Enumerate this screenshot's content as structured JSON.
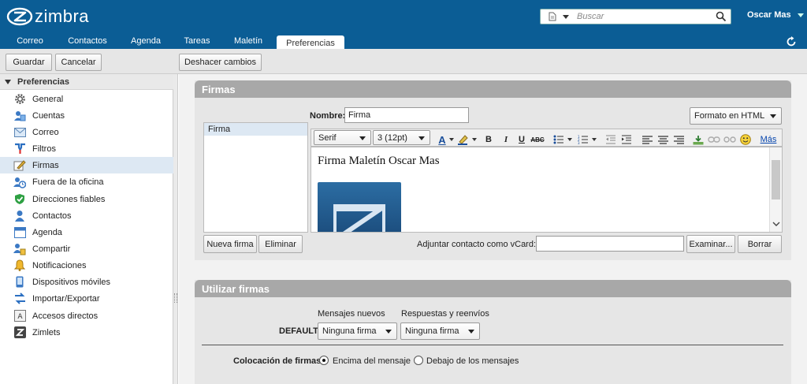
{
  "header": {
    "logo_text": "zimbra",
    "search_placeholder": "Buscar",
    "user_name": "Oscar Mas"
  },
  "nav": {
    "tabs": [
      "Correo",
      "Contactos",
      "Agenda",
      "Tareas",
      "Maletín",
      "Preferencias"
    ],
    "active_tab": "Preferencias"
  },
  "toolbar": {
    "save_label": "Guardar",
    "cancel_label": "Cancelar",
    "undo_label": "Deshacer cambios"
  },
  "sidebar": {
    "title": "Preferencias",
    "items": [
      {
        "label": "General",
        "icon": "gear-icon"
      },
      {
        "label": "Cuentas",
        "icon": "accounts-icon"
      },
      {
        "label": "Correo",
        "icon": "mail-icon"
      },
      {
        "label": "Filtros",
        "icon": "filter-icon"
      },
      {
        "label": "Firmas",
        "icon": "signature-icon"
      },
      {
        "label": "Fuera de la oficina",
        "icon": "out-of-office-icon"
      },
      {
        "label": "Direcciones fiables",
        "icon": "shield-icon"
      },
      {
        "label": "Contactos",
        "icon": "contacts-icon"
      },
      {
        "label": "Agenda",
        "icon": "calendar-icon"
      },
      {
        "label": "Compartir",
        "icon": "share-icon"
      },
      {
        "label": "Notificaciones",
        "icon": "bell-icon"
      },
      {
        "label": "Dispositivos móviles",
        "icon": "mobile-icon"
      },
      {
        "label": "Importar/Exportar",
        "icon": "import-export-icon"
      },
      {
        "label": "Accesos directos",
        "icon": "shortcuts-icon"
      },
      {
        "label": "Zimlets",
        "icon": "zimlets-icon"
      }
    ],
    "selected": "Firmas"
  },
  "firmas": {
    "title": "Firmas",
    "list": [
      "Firma"
    ],
    "name_label": "Nombre:",
    "name_value": "Firma",
    "format_select": "Formato en HTML",
    "font_family": "Serif",
    "font_size": "3 (12pt)",
    "more_link": "Más",
    "editor_text": "Firma Maletín Oscar Mas",
    "new_button": "Nueva firma",
    "delete_button": "Eliminar",
    "vcard_label": "Adjuntar contacto como vCard:",
    "vcard_value": "",
    "browse_button": "Examinar...",
    "clear_button": "Borrar"
  },
  "usar": {
    "title": "Utilizar firmas",
    "col_new": "Mensajes nuevos",
    "col_reply": "Respuestas y reenvíos",
    "row_label": "DEFAULT:",
    "new_value": "Ninguna firma",
    "reply_value": "Ninguna firma",
    "placement_label": "Colocación de firmas:",
    "opt_above": "Encima del mensaje",
    "opt_below": "Debajo de los mensajes",
    "placement_selected": "above"
  },
  "colors": {
    "header_bg": "#0b5d95",
    "panel_head": "#a8a8a8",
    "selected_row": "#dde8f3"
  }
}
